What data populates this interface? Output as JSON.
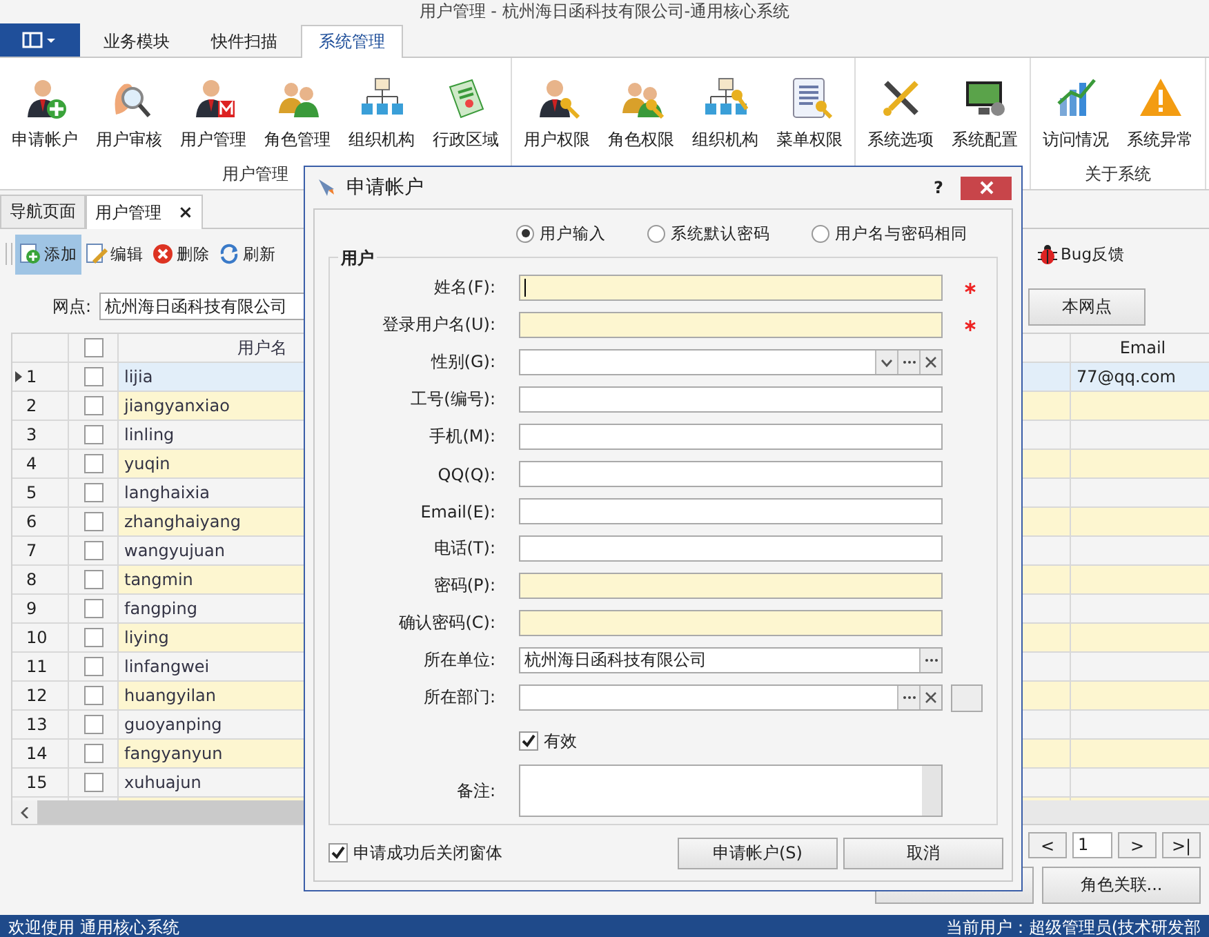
{
  "window": {
    "title": "用户管理 - 杭州海日函科技有限公司-通用核心系统"
  },
  "ribbon": {
    "tabs": [
      {
        "label": "业务模块",
        "selected": false
      },
      {
        "label": "快件扫描",
        "selected": false
      },
      {
        "label": "系统管理",
        "selected": true
      }
    ],
    "groups": [
      {
        "label": "用户管理",
        "items": [
          {
            "label": "申请帐户",
            "kind": "user_add"
          },
          {
            "label": "用户审核",
            "kind": "audit"
          },
          {
            "label": "用户管理",
            "kind": "user_manage"
          },
          {
            "label": "角色管理",
            "kind": "role"
          },
          {
            "label": "组织机构",
            "kind": "org"
          },
          {
            "label": "行政区域",
            "kind": "region"
          }
        ]
      },
      {
        "items": [
          {
            "label": "用户权限",
            "kind": "user_perm"
          },
          {
            "label": "角色权限",
            "kind": "role_perm"
          },
          {
            "label": "组织机构",
            "kind": "org_perm"
          },
          {
            "label": "菜单权限",
            "kind": "menu_perm"
          }
        ]
      },
      {
        "items": [
          {
            "label": "系统选项",
            "kind": "options"
          },
          {
            "label": "系统配置",
            "kind": "config"
          }
        ]
      },
      {
        "label": "关于系统",
        "items": [
          {
            "label": "访问情况",
            "kind": "visits"
          },
          {
            "label": "系统异常",
            "kind": "error"
          }
        ]
      }
    ]
  },
  "doc_tabs": [
    {
      "label": "导航页面",
      "selected": false
    },
    {
      "label": "用户管理",
      "selected": true,
      "close": "×"
    }
  ],
  "toolbar": [
    {
      "label": "添加",
      "kind": "add",
      "selected": true
    },
    {
      "label": "编辑",
      "kind": "edit",
      "selected": false
    },
    {
      "label": "删除",
      "kind": "delete",
      "selected": false
    },
    {
      "label": "刷新",
      "kind": "refresh",
      "selected": false
    }
  ],
  "bug_feedback": "Bug反馈",
  "filter": {
    "label": "网点:",
    "value": "杭州海日函科技有限公司",
    "button": "本网点"
  },
  "table": {
    "columns": [
      "用户名",
      "Email"
    ],
    "all_checked": false,
    "rows": [
      {
        "index": "1",
        "username": "lijia",
        "email": "77@qq.com",
        "selected": true,
        "checked": false
      },
      {
        "index": "2",
        "username": "jiangyanxiao",
        "selected": false,
        "checked": false
      },
      {
        "index": "3",
        "username": "linling",
        "selected": false,
        "checked": false
      },
      {
        "index": "4",
        "username": "yuqin",
        "selected": false,
        "checked": false
      },
      {
        "index": "5",
        "username": "langhaixia",
        "selected": false,
        "checked": false
      },
      {
        "index": "6",
        "username": "zhanghaiyang",
        "selected": false,
        "checked": false
      },
      {
        "index": "7",
        "username": "wangyujuan",
        "selected": false,
        "checked": false
      },
      {
        "index": "8",
        "username": "tangmin",
        "selected": false,
        "checked": false
      },
      {
        "index": "9",
        "username": "fangping",
        "selected": false,
        "checked": false
      },
      {
        "index": "10",
        "username": "liying",
        "selected": false,
        "checked": false
      },
      {
        "index": "11",
        "username": "linfangwei",
        "selected": false,
        "checked": false
      },
      {
        "index": "12",
        "username": "huangyilan",
        "selected": false,
        "checked": false
      },
      {
        "index": "13",
        "username": "guoyanping",
        "selected": false,
        "checked": false
      },
      {
        "index": "14",
        "username": "fangyanyun",
        "selected": false,
        "checked": false
      },
      {
        "index": "15",
        "username": "xuhuajun",
        "selected": false,
        "checked": false
      }
    ]
  },
  "pager": {
    "prev": "<",
    "page": "1",
    "next": ">",
    "last": ">|"
  },
  "bottom_buttons": [
    "角色关联..."
  ],
  "status_bar": {
    "left": "欢迎使用 通用核心系统",
    "right": "当前用户：超级管理员(技术研发部"
  },
  "dialog": {
    "title": "申请帐户",
    "help": "?",
    "radios": [
      {
        "label": "用户输入",
        "selected": true
      },
      {
        "label": "系统默认密码",
        "selected": false
      },
      {
        "label": "用户名与密码相同",
        "selected": false
      }
    ],
    "group_label": "用户",
    "fields": [
      {
        "label": "姓名(F):",
        "highlighted": true,
        "required": true,
        "focused": true
      },
      {
        "label": "登录用户名(U):",
        "highlighted": true,
        "required": true
      },
      {
        "label": "性别(G):",
        "dropdown": true,
        "browse": true,
        "clear": true
      },
      {
        "label": "工号(编号):"
      },
      {
        "label": "手机(M):"
      },
      {
        "label": "QQ(Q):"
      },
      {
        "label": "Email(E):"
      },
      {
        "label": "电话(T):"
      },
      {
        "label": "密码(P):",
        "highlighted": true
      },
      {
        "label": "确认密码(C):",
        "highlighted": true
      },
      {
        "label": "所在单位:",
        "value": "杭州海日函科技有限公司",
        "browse": true
      },
      {
        "label": "所在部门:",
        "browse": true,
        "clear": true,
        "side_button": true
      }
    ],
    "valid": {
      "label": "有效",
      "checked": true
    },
    "remark_label": "备注:",
    "close_after": {
      "label": "申请成功后关闭窗体",
      "checked": true
    },
    "buttons": [
      "申请帐户(S)",
      "取消"
    ]
  }
}
